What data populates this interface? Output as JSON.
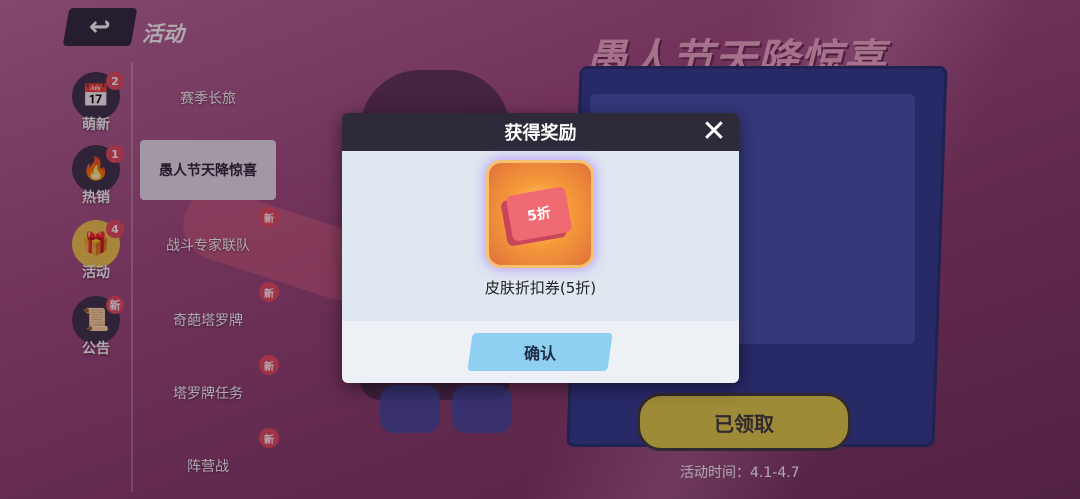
{
  "header": {
    "back_icon": "↩",
    "title": "活动"
  },
  "nav": [
    {
      "label": "萌新",
      "badge": "2",
      "icon": "calendar-icon",
      "glyph": "📅",
      "active": false
    },
    {
      "label": "热销",
      "badge": "1",
      "icon": "flame-icon",
      "glyph": "🔥",
      "active": false
    },
    {
      "label": "活动",
      "badge": "4",
      "icon": "gift-icon",
      "glyph": "🎁",
      "active": true
    },
    {
      "label": "公告",
      "badge": "新",
      "icon": "notice-icon",
      "glyph": "📜",
      "active": false
    }
  ],
  "activities": [
    {
      "label": "赛季长旅",
      "new": false
    },
    {
      "label": "愚人节天降惊喜",
      "new": false,
      "selected": true
    },
    {
      "label": "战斗专家联队",
      "new": true
    },
    {
      "label": "奇葩塔罗牌",
      "new": true
    },
    {
      "label": "塔罗牌任务",
      "new": true
    },
    {
      "label": "阵营战",
      "new": true
    }
  ],
  "new_badge": "新",
  "event": {
    "title": "愚人节天降惊喜",
    "claimed_label": "已领取",
    "time": "活动时间：4.1-4.7"
  },
  "modal": {
    "title": "获得奖励",
    "close_icon": "✕",
    "reward_name": "皮肤折扣券(5折)",
    "reward_ticket_text": "5折",
    "confirm_label": "确认"
  },
  "colors": {
    "accent_yellow": "#e3d247",
    "confirm_blue": "#8fd0f2",
    "badge_red": "#e84a5f"
  }
}
